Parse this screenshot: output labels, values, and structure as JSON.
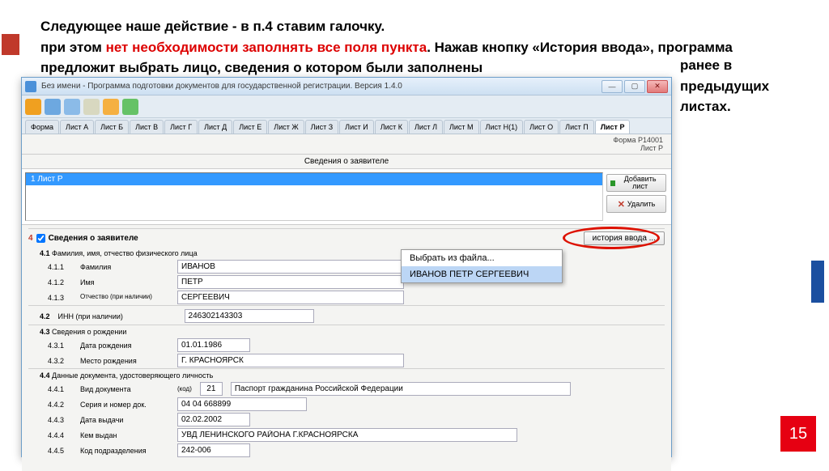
{
  "slide": {
    "line1": "Следующее наше действие - в п.4 ставим галочку.",
    "line2_pre": "при этом ",
    "line2_red": "нет необходимости заполнять все поля пункта",
    "line2_post": ". Нажав кнопку «История ввода», программа предложит выбрать лицо, сведения о котором были заполнены",
    "side": "ранее в предыдущих листах.",
    "page_number": "15"
  },
  "window": {
    "title": "Без имени - Программа подготовки документов для государственной регистрации. Версия 1.4.0",
    "toolbar_icons": [
      {
        "name": "folder-icon",
        "color": "#f0a020"
      },
      {
        "name": "save-icon",
        "color": "#6da8e0"
      },
      {
        "name": "copy-icon",
        "color": "#8bbbe8"
      },
      {
        "name": "mail-icon",
        "color": "#d8d8c0"
      },
      {
        "name": "sun-icon",
        "color": "#f5b041"
      },
      {
        "name": "gear-icon",
        "color": "#66c266"
      }
    ],
    "tabs": [
      "Форма",
      "Лист А",
      "Лист Б",
      "Лист В",
      "Лист Г",
      "Лист Д",
      "Лист Е",
      "Лист Ж",
      "Лист З",
      "Лист И",
      "Лист К",
      "Лист Л",
      "Лист М",
      "Лист Н(1)",
      "Лист О",
      "Лист П",
      "Лист Р"
    ],
    "active_tab": 16,
    "form_code": "Форма Р14001",
    "sheet_code": "Лист Р",
    "section_bar": "Сведения о заявителе",
    "list_selected": "1 Лист Р",
    "btn_add": "Добавить лист",
    "btn_delete": "Удалить",
    "group4": {
      "num": "4",
      "label": "Сведения о заявителе",
      "history_btn": "история ввода ..."
    },
    "group41": {
      "num": "4.1",
      "label": "Фамилия, имя, отчество физического лица"
    },
    "f411": {
      "num": "4.1.1",
      "label": "Фамилия",
      "value": "ИВАНОВ"
    },
    "f412": {
      "num": "4.1.2",
      "label": "Имя",
      "value": "ПЕТР"
    },
    "f413": {
      "num": "4.1.3",
      "label": "Отчество (при наличии)",
      "value": "СЕРГЕЕВИЧ"
    },
    "group42": {
      "num": "4.2",
      "label": "ИНН (при наличии)",
      "value": "246302143303"
    },
    "group43": {
      "num": "4.3",
      "label": "Сведения о рождении"
    },
    "f431": {
      "num": "4.3.1",
      "label": "Дата рождения",
      "value": "01.01.1986"
    },
    "f432": {
      "num": "4.3.2",
      "label": "Место рождения",
      "value": "Г. КРАСНОЯРСК"
    },
    "group44": {
      "num": "4.4",
      "label": "Данные документа, удостоверяющего личность"
    },
    "f441": {
      "num": "4.4.1",
      "label": "Вид документа",
      "code_label": "(код)",
      "code": "21",
      "value": "Паспорт гражданина Российской Федерации"
    },
    "f442": {
      "num": "4.4.2",
      "label": "Серия и номер док.",
      "value": "04 04 668899"
    },
    "f443": {
      "num": "4.4.3",
      "label": "Дата выдачи",
      "value": "02.02.2002"
    },
    "f444": {
      "num": "4.4.4",
      "label": "Кем выдан",
      "value": "УВД ЛЕНИНСКОГО РАЙОНА Г.КРАСНОЯРСКА"
    },
    "f445": {
      "num": "4.4.5",
      "label": "Код подразделения",
      "value": "242-006"
    },
    "dropdown": {
      "item1": "Выбрать из файла...",
      "item2": "ИВАНОВ ПЕТР СЕРГЕЕВИЧ"
    }
  }
}
